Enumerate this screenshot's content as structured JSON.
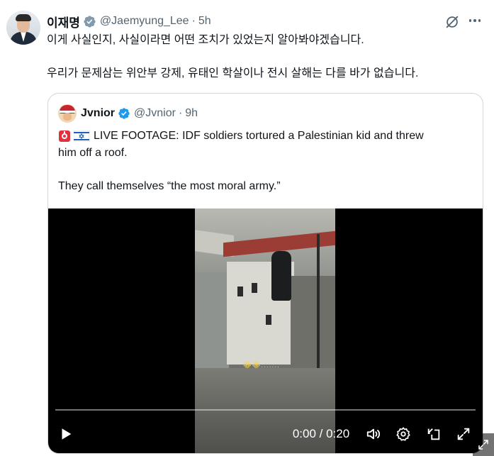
{
  "author": {
    "name": "이재명",
    "handle": "@Jaemyung_Lee",
    "separator": "·",
    "time": "5h",
    "verified_icon": "verified-badge-icon"
  },
  "tweet": {
    "text_line1": "이게 사실인지, 사실이라면 어떤 조치가 있었는지 알아봐야겠습니다.",
    "text_line2": "우리가 문제삼는 위안부 강제, 유태인 학살이나 전시 살해는 다를 바가 없습니다."
  },
  "actions": {
    "grok_icon": "grok-icon",
    "more_icon": "more-options-icon"
  },
  "quoted": {
    "name": "Jvnior",
    "handle": "@Jvnior",
    "separator": "·",
    "time": "9h",
    "line1": "LIVE FOOTAGE: IDF soldiers tortured a Palestinian kid and threw",
    "line2": "him off a roof.",
    "line3": "They call themselves “the most moral army.”",
    "emojis": [
      "siren-emoji",
      "israel-flag-emoji"
    ]
  },
  "video": {
    "timecode": "0:00 / 0:20",
    "progress": 0,
    "overlay_text": "😂😂.......",
    "controls": [
      "play-icon",
      "volume-icon",
      "settings-icon",
      "popout-icon",
      "fullscreen-icon"
    ]
  },
  "colors": {
    "text": "#0f1419",
    "secondary": "#536471",
    "verified": "#829aab",
    "border": "#cfd9de"
  }
}
